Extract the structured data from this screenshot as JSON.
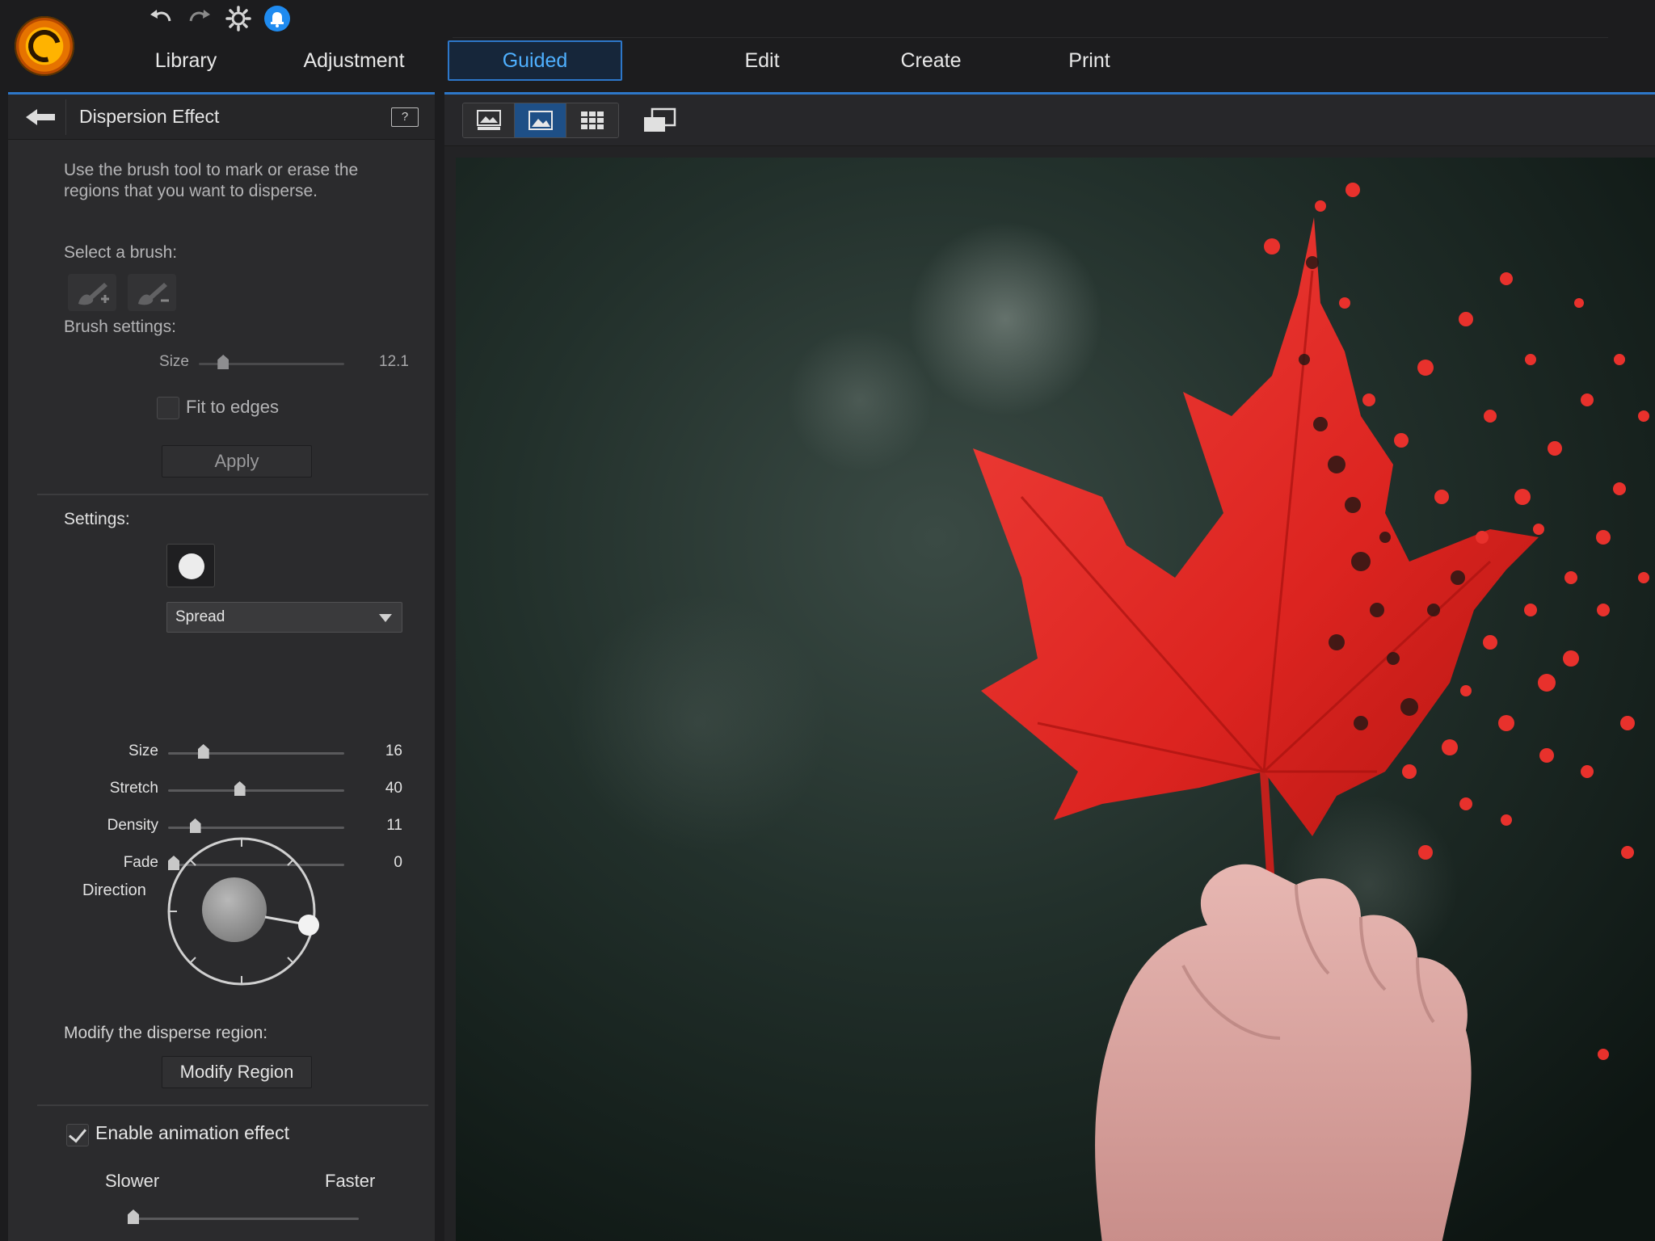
{
  "nav": {
    "tabs": [
      {
        "label": "Library"
      },
      {
        "label": "Adjustment"
      },
      {
        "label": "Guided"
      },
      {
        "label": "Edit"
      },
      {
        "label": "Create"
      },
      {
        "label": "Print"
      }
    ],
    "active": "Guided"
  },
  "quick_actions": [
    "undo-icon",
    "redo-icon",
    "settings-gear-icon",
    "notification-bell-icon"
  ],
  "panel": {
    "title": "Dispersion Effect",
    "help_glyph": "?",
    "instructions_line1": "Use the brush tool to mark or erase the",
    "instructions_line2": "regions that you want to disperse.",
    "select_brush_label": "Select a brush:",
    "brush_settings_label": "Brush settings:",
    "brush_size": {
      "label": "Size",
      "value": "12.1",
      "fraction": 0.14
    },
    "fit_to_edges_label": "Fit to edges",
    "fit_to_edges_checked": false,
    "apply_label": "Apply",
    "settings_label": "Settings:",
    "spread_select_value": "Spread",
    "sliders": [
      {
        "label": "Size",
        "value": "16",
        "fraction": 0.18
      },
      {
        "label": "Stretch",
        "value": "40",
        "fraction": 0.4
      },
      {
        "label": "Density",
        "value": "11",
        "fraction": 0.13
      },
      {
        "label": "Fade",
        "value": "0",
        "fraction": 0.0
      }
    ],
    "direction_label": "Direction",
    "modify_region_prompt": "Modify the disperse region:",
    "modify_region_button": "Modify Region",
    "animation_label": "Enable animation effect",
    "animation_checked": true,
    "slower_label": "Slower",
    "faster_label": "Faster",
    "speed_fraction": 0.0
  },
  "colors": {
    "accent": "#2d77c9",
    "accent_text": "#4fb0ff",
    "panel_bg": "#2b2b2d",
    "leaf_red": "#e32a25"
  }
}
